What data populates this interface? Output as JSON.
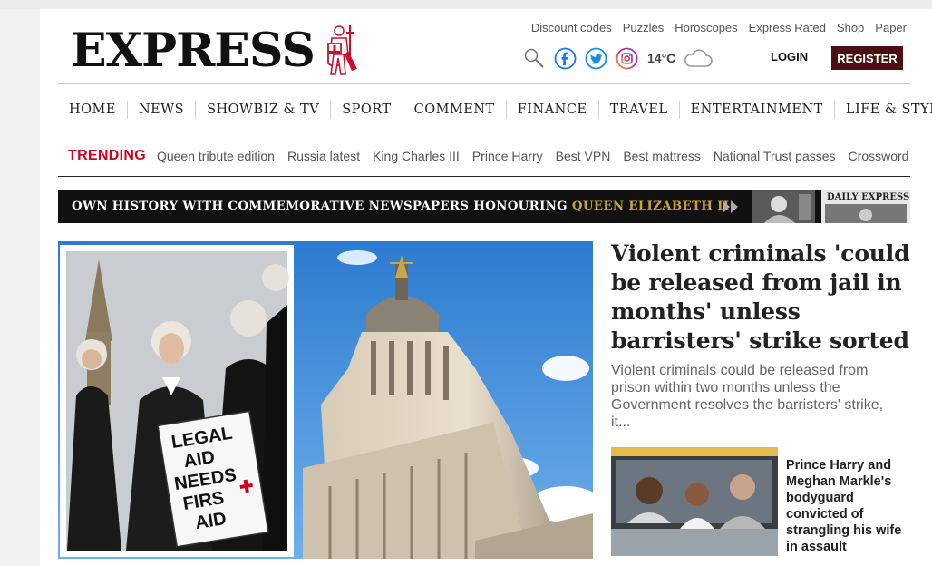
{
  "brand": {
    "logo_text": "EXPRESS"
  },
  "top_links": [
    "Discount codes",
    "Puzzles",
    "Horoscopes",
    "Express Rated",
    "Shop",
    "Paper"
  ],
  "utility": {
    "icons": [
      "search-icon",
      "facebook-icon",
      "twitter-icon",
      "instagram-icon"
    ],
    "temperature": "14°C",
    "weather_icon": "cloud-icon",
    "login_label": "LOGIN",
    "register_label": "REGISTER"
  },
  "nav": [
    "HOME",
    "NEWS",
    "SHOWBIZ & TV",
    "SPORT",
    "COMMENT",
    "FINANCE",
    "TRAVEL",
    "ENTERTAINMENT",
    "LIFE & STYLE"
  ],
  "trending": {
    "label": "TRENDING",
    "links": [
      "Queen tribute edition",
      "Russia latest",
      "King Charles III",
      "Prince Harry",
      "Best VPN",
      "Best mattress",
      "National Trust passes",
      "Crossword"
    ]
  },
  "banner": {
    "text": "OWN HISTORY WITH COMMEMORATIVE NEWSPAPERS HONOURING ",
    "highlight": "QUEEN ELIZABETH II",
    "newspaper_masthead": "DAILY EXPRESS"
  },
  "hero": {
    "placard_lines": [
      "LEGAL",
      "AID",
      "NEEDS",
      "FIRS",
      "AID"
    ],
    "headline": "Violent criminals 'could be released from jail in months' unless barristers' strike sorted",
    "standfirst": "Violent criminals could be released from prison within two months unless the Government resolves the barristers' strike, it..."
  },
  "secondary": {
    "title": "Prince Harry and Meghan Markle's bodyguard convicted of strangling his wife in assault"
  },
  "colors": {
    "register_bg": "#4a0f12",
    "trending_red": "#d0021b",
    "banner_gold": "#c9a23a"
  }
}
